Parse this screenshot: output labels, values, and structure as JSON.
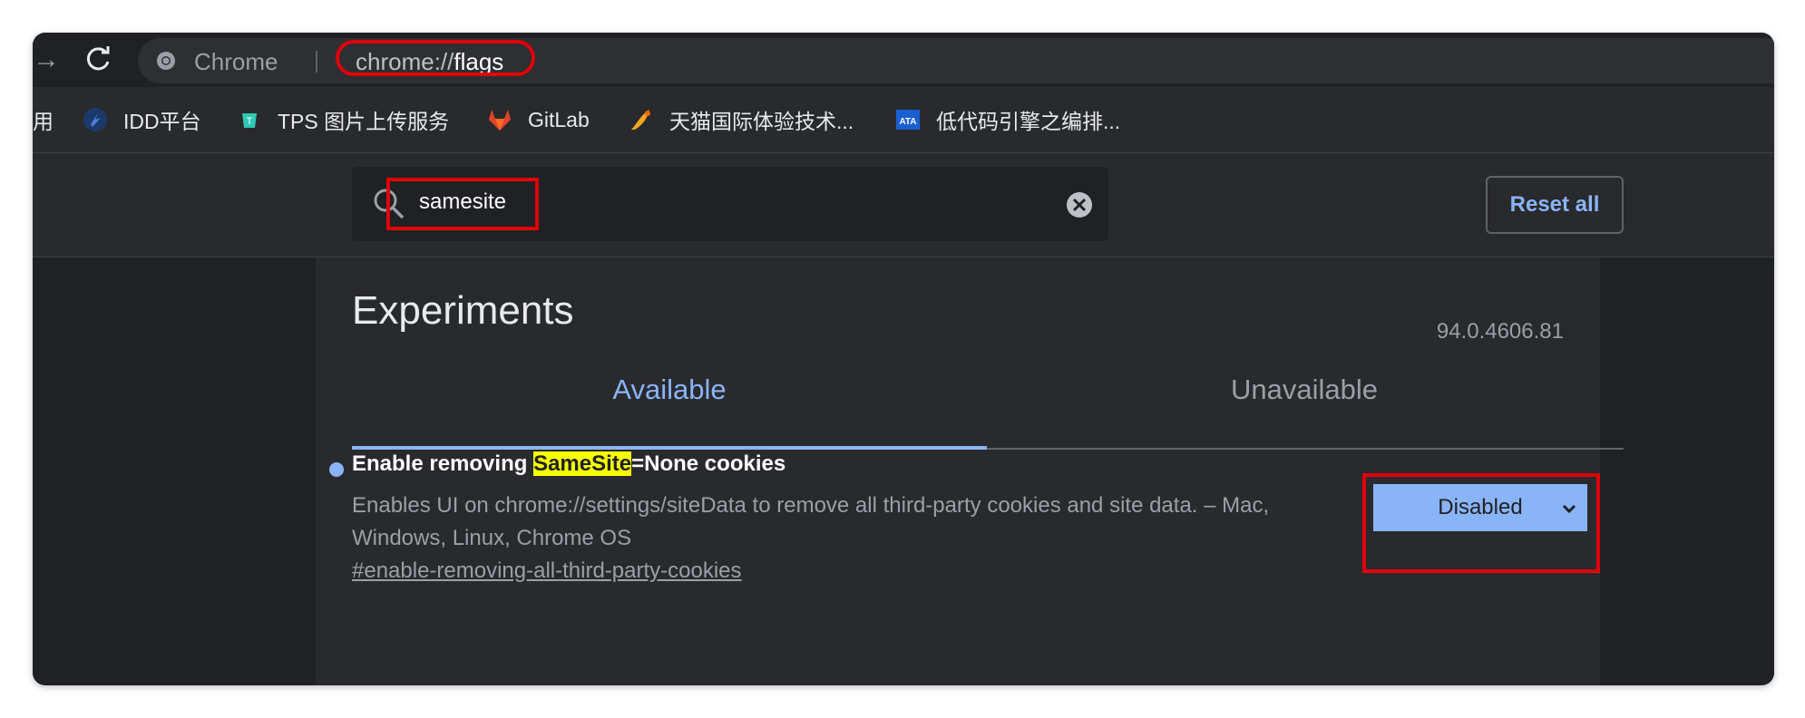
{
  "toolbar": {
    "site_label": "Chrome",
    "url_scheme": "chrome://",
    "url_host": "flags"
  },
  "bookmarks": [
    {
      "label": "用",
      "icon": "partial-bookmark"
    },
    {
      "label": "IDD平台",
      "icon": "idd-icon"
    },
    {
      "label": "TPS 图片上传服务",
      "icon": "tps-icon"
    },
    {
      "label": "GitLab",
      "icon": "gitlab-icon"
    },
    {
      "label": "天猫国际体验技术...",
      "icon": "tmall-icon"
    },
    {
      "label": "低代码引擎之编排...",
      "icon": "ata-icon"
    }
  ],
  "search": {
    "value": "samesite"
  },
  "header": {
    "reset_label": "Reset all"
  },
  "experiments": {
    "title": "Experiments",
    "version": "94.0.4606.81",
    "tabs": [
      {
        "label": "Available",
        "active": true
      },
      {
        "label": "Unavailable",
        "active": false
      }
    ]
  },
  "flag": {
    "title_prefix": "Enable removing ",
    "title_highlight": "SameSite",
    "title_suffix": "=None cookies",
    "description": "Enables UI on chrome://settings/siteData to remove all third-party cookies and site data. – Mac, Windows, Linux, Chrome OS",
    "link": "#enable-removing-all-third-party-cookies",
    "selected": "Disabled"
  },
  "colors": {
    "accent": "#8ab4f8",
    "highlight": "#f6ff00",
    "annotation": "#e0000a",
    "background": "#202124"
  }
}
